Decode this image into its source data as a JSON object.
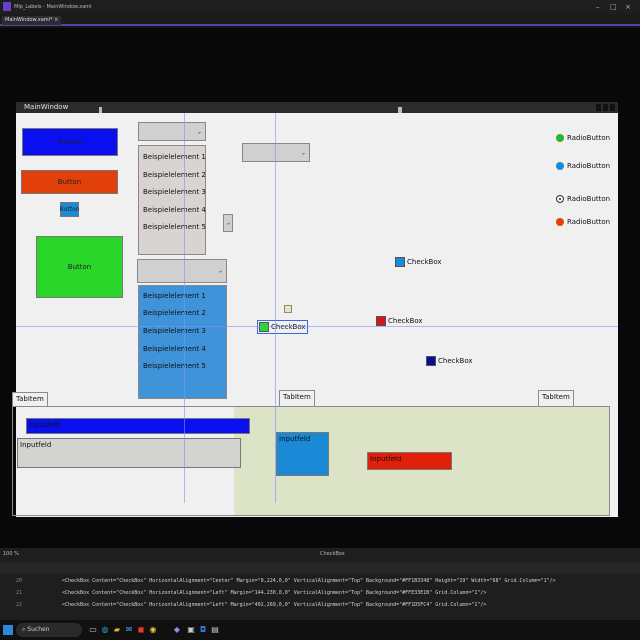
{
  "app": {
    "title": "Mlp_Labels - MainWindow.xaml"
  },
  "tabs": [
    {
      "label": "MainWindow.xaml* ×"
    }
  ],
  "designer": {
    "window_title": "MainWindow",
    "buttons": [
      "Button",
      "Button",
      "Button",
      "Button"
    ],
    "list1": [
      "Beispielelement 1",
      "Beispielelement 2",
      "Beispielelement 3",
      "Beispielelement 4",
      "Beispielelement 5"
    ],
    "list2": [
      "Beispielelement 1",
      "Beispielelement 2",
      "Beispielelement 3",
      "Beispielelement 4",
      "Beispielelement 5"
    ],
    "radios": [
      "RadioButton",
      "RadioButton",
      "RadioButton",
      "RadioButton"
    ],
    "checkboxes": [
      "CheckBox",
      "CheckBox",
      "CheckBox",
      "CheckBox"
    ],
    "tabitems": [
      "TabItem",
      "TabItem",
      "TabItem"
    ],
    "inputs": [
      "Inputfeld",
      "Inputfeld",
      "Inputfeld",
      "Inputfeld"
    ]
  },
  "statusbar": {
    "zoom": "100 %",
    "element_path": "CheckBox"
  },
  "code_lines": [
    {
      "num": "20",
      "text": "<CheckBox Content=\"CheckBox\" HorizontalAlignment=\"Center\" Margin=\"0,224,0,0\" VerticalAlignment=\"Top\" Background=\"#FF1B3348\" Height=\"19\" Width=\"68\" Grid.Column=\"1\"/>"
    },
    {
      "num": "21",
      "text": "<CheckBox Content=\"CheckBox\" HorizontalAlignment=\"Left\" Margin=\"144,230,0,0\" VerticalAlignment=\"Top\" Background=\"#FFE33E1B\" Grid.Column=\"1\"/>"
    },
    {
      "num": "22",
      "text": "<CheckBox Content=\"CheckBox\" HorizontalAlignment=\"Left\" Margin=\"402,269,0,0\" VerticalAlignment=\"Top\" Background=\"#FF1D5FC4\" Grid.Column=\"1\"/>"
    }
  ],
  "taskbar": {
    "search_placeholder": "Suchen"
  },
  "colors": {
    "blue_button": "#0a0ff0",
    "orange_button": "#e2400a",
    "cyan_button": "#1a8ad6",
    "green_button": "#2ad62a",
    "selected_list": "#3f93d9",
    "tab_background": "#dde3c6"
  }
}
